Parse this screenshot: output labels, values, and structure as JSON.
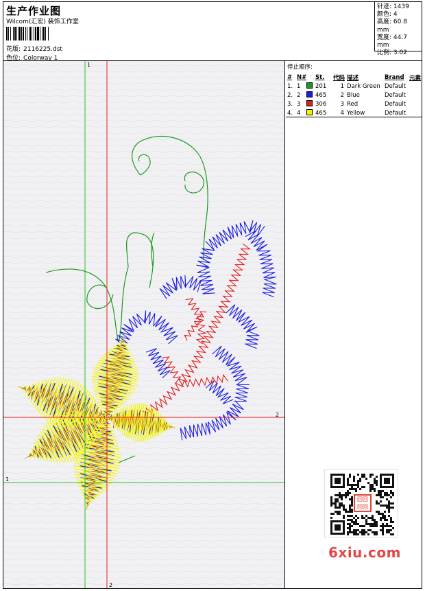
{
  "header": {
    "title": "生产作业图",
    "company": "Wilcom(汇宏) 装饰工作室",
    "design_label": "花版:",
    "design_value": "2116225.dst",
    "colorway_label": "色位:",
    "colorway_value": "Colorway 1"
  },
  "stats": {
    "stitches_label": "针迹:",
    "stitches_value": "1439",
    "colors_label": "颜色:",
    "colors_value": "4",
    "height_label": "高度:",
    "height_value": "60.8 mm",
    "width_label": "宽度:",
    "width_value": "44.7 mm",
    "scale_label": "比例:",
    "scale_value": "3.02"
  },
  "legend": {
    "title": "停止顺序:",
    "headers": {
      "idx": "#",
      "n": "N#",
      "st": "St.",
      "code": "代码",
      "desc": "描述",
      "brand": "Brand",
      "element": "元素"
    },
    "rows": [
      {
        "idx": "1.",
        "n": "1",
        "color": "#1a9a1a",
        "st": "201",
        "code": "1",
        "desc": "Dark Green",
        "brand": "Default"
      },
      {
        "idx": "2.",
        "n": "2",
        "color": "#1c1ce0",
        "st": "465",
        "code": "2",
        "desc": "Blue",
        "brand": "Default"
      },
      {
        "idx": "3.",
        "n": "3",
        "color": "#e01c1c",
        "st": "306",
        "code": "3",
        "desc": "Red",
        "brand": "Default"
      },
      {
        "idx": "4.",
        "n": "4",
        "color": "#f5f500",
        "st": "465",
        "code": "4",
        "desc": "Yellow",
        "brand": "Default"
      }
    ]
  },
  "guides": {
    "green_label_top": "1",
    "green_label_left": "1",
    "red_label_right": "2",
    "red_label_bottom": "2"
  },
  "colors": {
    "green": "#1a9a1a",
    "blue": "#1c1ce0",
    "red": "#e01c1c",
    "yellow": "#f5f500",
    "guide_green": "#22c022",
    "guide_red": "#e82020"
  },
  "qr": {
    "stamp": "回回回回"
  },
  "watermark": "6xiu.com"
}
